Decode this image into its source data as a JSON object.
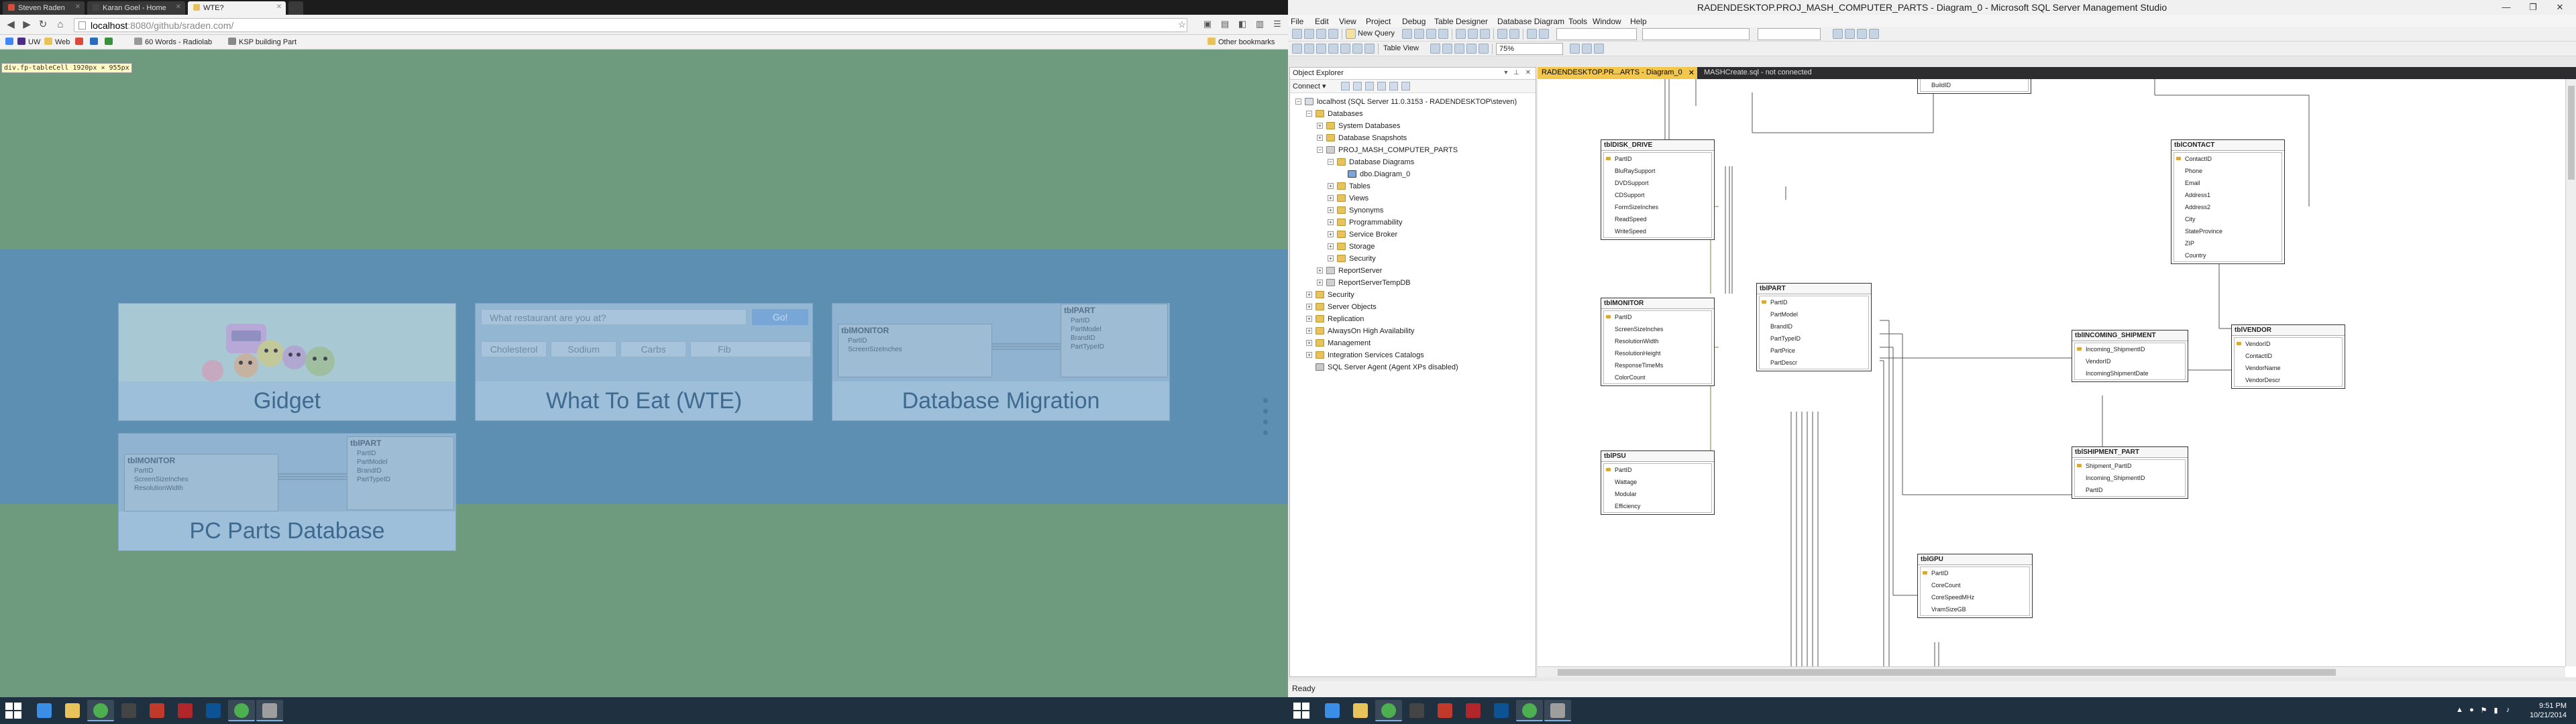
{
  "chrome": {
    "tabs": [
      {
        "label": "Steven Raden",
        "fav_color": "#d84b3a",
        "active": false
      },
      {
        "label": "Karan Goel - Home",
        "fav_color": "#444444",
        "active": false
      },
      {
        "label": "WTE?",
        "fav_color": "#e8c25a",
        "active": true
      }
    ],
    "url_host": "localhost",
    "url_rest": ":8080/github/sraden.com/",
    "bookmarks": [
      {
        "label": "UW",
        "color": "#4b2e83"
      },
      {
        "label": "Web",
        "color": "#e8c25a"
      },
      {
        "label": "",
        "color": "#d84b3a"
      },
      {
        "label": "",
        "color": "#2a6ebb"
      },
      {
        "label": "",
        "color": "#3c8f3c"
      },
      {
        "label": "60 Words - Radiolab",
        "color": "#999999"
      },
      {
        "label": "KSP building Part",
        "color": "#888888"
      }
    ],
    "other_bookmarks": "Other bookmarks",
    "dev_tooltip": "div.fp-tableCell 1920px × 955px"
  },
  "portfolio": {
    "cards": [
      {
        "title": "Gidget"
      },
      {
        "title": "What To Eat (WTE)",
        "search_placeholder": "What restaurant are you at?",
        "search_button": "Go!",
        "chips": [
          "Cholesterol",
          "Sodium",
          "Carbs",
          "Fib"
        ]
      },
      {
        "title": "Database Migration",
        "table_a": {
          "name": "tblMONITOR",
          "rows": [
            "PartID",
            "ScreenSizeInches"
          ]
        },
        "table_b": {
          "name": "tblPART",
          "rows": [
            "PartID",
            "PartModel",
            "BrandID",
            "PartTypeID"
          ]
        }
      },
      {
        "title": "PC Parts Database",
        "table_a": {
          "name": "tblMONITOR",
          "rows": [
            "PartID",
            "ScreenSizeInches",
            "ResolutionWidth"
          ]
        },
        "table_b": {
          "name": "tblPART",
          "rows": [
            "PartID",
            "PartModel",
            "BrandID",
            "PartTypeID"
          ]
        }
      }
    ]
  },
  "ssms": {
    "title": "RADENDESKTOP.PROJ_MASH_COMPUTER_PARTS - Diagram_0 - Microsoft SQL Server Management Studio",
    "menu": [
      "File",
      "Edit",
      "View",
      "Project",
      "Debug",
      "Table Designer",
      "Database Diagram",
      "Tools",
      "Window",
      "Help"
    ],
    "toolbar": {
      "new_query": "New Query",
      "table_view": "Table View",
      "zoom": "75%"
    },
    "object_explorer": {
      "header": "Object Explorer",
      "connect": "Connect",
      "tree": [
        {
          "label": "localhost (SQL Server 11.0.3153 - RADENDESKTOP\\steven)",
          "depth": 0,
          "icon": "server",
          "exp": "-"
        },
        {
          "label": "Databases",
          "depth": 1,
          "icon": "folder",
          "exp": "-"
        },
        {
          "label": "System Databases",
          "depth": 2,
          "icon": "folder",
          "exp": "+"
        },
        {
          "label": "Database Snapshots",
          "depth": 2,
          "icon": "folder",
          "exp": "+"
        },
        {
          "label": "PROJ_MASH_COMPUTER_PARTS",
          "depth": 2,
          "icon": "dbico",
          "exp": "-"
        },
        {
          "label": "Database Diagrams",
          "depth": 3,
          "icon": "folder",
          "exp": "-"
        },
        {
          "label": "dbo.Diagram_0",
          "depth": 4,
          "icon": "diagico",
          "exp": ""
        },
        {
          "label": "Tables",
          "depth": 3,
          "icon": "folder",
          "exp": "+"
        },
        {
          "label": "Views",
          "depth": 3,
          "icon": "folder",
          "exp": "+"
        },
        {
          "label": "Synonyms",
          "depth": 3,
          "icon": "folder",
          "exp": "+"
        },
        {
          "label": "Programmability",
          "depth": 3,
          "icon": "folder",
          "exp": "+"
        },
        {
          "label": "Service Broker",
          "depth": 3,
          "icon": "folder",
          "exp": "+"
        },
        {
          "label": "Storage",
          "depth": 3,
          "icon": "folder",
          "exp": "+"
        },
        {
          "label": "Security",
          "depth": 3,
          "icon": "folder",
          "exp": "+"
        },
        {
          "label": "ReportServer",
          "depth": 2,
          "icon": "dbico",
          "exp": "+"
        },
        {
          "label": "ReportServerTempDB",
          "depth": 2,
          "icon": "dbico",
          "exp": "+"
        },
        {
          "label": "Security",
          "depth": 1,
          "icon": "folder",
          "exp": "+"
        },
        {
          "label": "Server Objects",
          "depth": 1,
          "icon": "folder",
          "exp": "+"
        },
        {
          "label": "Replication",
          "depth": 1,
          "icon": "folder",
          "exp": "+"
        },
        {
          "label": "AlwaysOn High Availability",
          "depth": 1,
          "icon": "folder",
          "exp": "+"
        },
        {
          "label": "Management",
          "depth": 1,
          "icon": "folder",
          "exp": "+"
        },
        {
          "label": "Integration Services Catalogs",
          "depth": 1,
          "icon": "folder",
          "exp": "+"
        },
        {
          "label": "SQL Server Agent (Agent XPs disabled)",
          "depth": 1,
          "icon": "agentico",
          "exp": ""
        }
      ]
    },
    "doc_tabs": [
      {
        "label": "RADENDESKTOP.PR...ARTS - Diagram_0",
        "active": true
      },
      {
        "label": "MASHCreate.sql - not connected",
        "active": false
      }
    ],
    "tables": [
      {
        "id": "buildid",
        "name": "",
        "rows": [
          "BuildID"
        ]
      },
      {
        "id": "disk",
        "name": "tblDISK_DRIVE",
        "rows": [
          "PartID",
          "BluRaySupport",
          "DVDSupport",
          "CDSupport",
          "FormSizeInches",
          "ReadSpeed",
          "WriteSpeed"
        ]
      },
      {
        "id": "monitor",
        "name": "tblMONITOR",
        "rows": [
          "PartID",
          "ScreenSizeInches",
          "ResolutionWidth",
          "ResolutionHeight",
          "ResponseTimeMs",
          "ColorCount"
        ]
      },
      {
        "id": "psu",
        "name": "tblPSU",
        "rows": [
          "PartID",
          "Wattage",
          "Modular",
          "Efficiency"
        ]
      },
      {
        "id": "part",
        "name": "tblPART",
        "rows": [
          "PartID",
          "PartModel",
          "BrandID",
          "PartTypeID",
          "PartPrice",
          "PartDescr"
        ]
      },
      {
        "id": "contact",
        "name": "tblCONTACT",
        "rows": [
          "ContactID",
          "Phone",
          "Email",
          "Address1",
          "Address2",
          "City",
          "StateProvince",
          "ZIP",
          "Country"
        ]
      },
      {
        "id": "incoming",
        "name": "tblINCOMING_SHIPMENT",
        "rows": [
          "Incoming_ShipmentID",
          "VendorID",
          "IncomingShipmentDate"
        ]
      },
      {
        "id": "vendor",
        "name": "tblVENDOR",
        "rows": [
          "VendorID",
          "ContactID",
          "VendorName",
          "VendorDescr"
        ]
      },
      {
        "id": "shipment_part",
        "name": "tblSHIPMENT_PART",
        "rows": [
          "Shipment_PartID",
          "Incoming_ShipmentID",
          "PartID"
        ]
      },
      {
        "id": "gpu",
        "name": "tblGPU",
        "rows": [
          "PartID",
          "CoreCount",
          "CoreSpeedMHz",
          "VramSizeGB"
        ]
      }
    ],
    "status": "Ready"
  },
  "taskbar": {
    "apps": [
      {
        "name": "ie-icon",
        "color": "#3a8ee6"
      },
      {
        "name": "explorer-icon",
        "color": "#e8c25a"
      },
      {
        "name": "chrome-icon",
        "color": "#4caf50"
      },
      {
        "name": "media-icon",
        "color": "#444444"
      },
      {
        "name": "acrobat-icon",
        "color": "#c0392b"
      },
      {
        "name": "filezilla-icon",
        "color": "#b0262a"
      },
      {
        "name": "photoshop-icon",
        "color": "#0b5394"
      },
      {
        "name": "chrome-icon-2",
        "color": "#4caf50"
      },
      {
        "name": "ssms-icon",
        "color": "#9e9e9e"
      }
    ],
    "time": "9:51 PM",
    "date": "10/21/2014"
  }
}
